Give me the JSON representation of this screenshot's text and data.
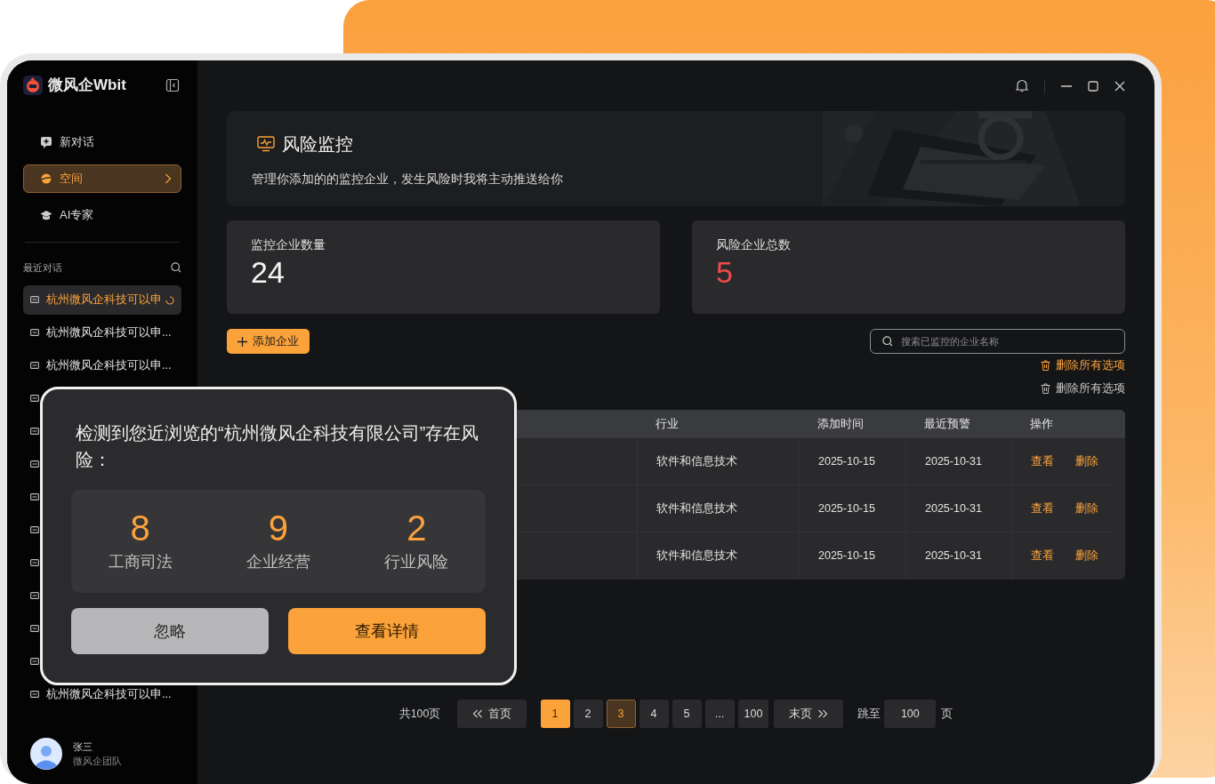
{
  "app": {
    "name": "微风企Wbit"
  },
  "menu": [
    {
      "label": "新对话",
      "kind": "new-chat",
      "selected": false
    },
    {
      "label": "空间",
      "kind": "space",
      "selected": true
    },
    {
      "label": "AI专家",
      "kind": "expert",
      "selected": false
    }
  ],
  "recent": {
    "title": "最近对话",
    "items": [
      {
        "kind": "chat",
        "text": "杭州微风企科技可以申",
        "selected": true,
        "loading": true
      },
      {
        "kind": "chat",
        "text": "杭州微风企科技可以申...",
        "selected": false,
        "loading": false
      },
      {
        "kind": "chat",
        "text": "杭州微风企科技可以申...",
        "selected": false,
        "loading": false
      },
      {
        "kind": "covered"
      },
      {
        "kind": "covered"
      },
      {
        "kind": "covered"
      },
      {
        "kind": "covered"
      },
      {
        "kind": "covered"
      },
      {
        "kind": "covered"
      },
      {
        "kind": "covered"
      },
      {
        "kind": "covered"
      },
      {
        "kind": "covered"
      },
      {
        "kind": "chat",
        "text": "杭州微风企科技可以申...",
        "selected": false,
        "loading": false
      }
    ]
  },
  "user": {
    "name": "张三",
    "team": "微风企团队"
  },
  "page": {
    "title": "风险监控",
    "subtitle": "管理你添加的的监控企业，发生风险时我将主动推送给你"
  },
  "stats": [
    {
      "label": "监控企业数量",
      "value": "24",
      "alert": false
    },
    {
      "label": "风险企业总数",
      "value": "5",
      "alert": true
    }
  ],
  "add_button": "添加企业",
  "search": {
    "placeholder": "搜索已监控的企业名称"
  },
  "bulk_actions": [
    {
      "label": "删除所有选项",
      "selected": true
    },
    {
      "label": "删除所有选项",
      "selected": false
    }
  ],
  "table": {
    "columns": [
      "行业",
      "添加时间",
      "最近预警",
      "操作"
    ],
    "rows": [
      {
        "industry": "软件和信息技术",
        "added": "2025-10-15",
        "warning": "2025-10-31",
        "actions": [
          "查看",
          "删除"
        ]
      },
      {
        "industry": "软件和信息技术",
        "added": "2025-10-15",
        "warning": "2025-10-31",
        "actions": [
          "查看",
          "删除"
        ]
      },
      {
        "industry": "软件和信息技术",
        "added": "2025-10-15",
        "warning": "2025-10-31",
        "actions": [
          "查看",
          "删除"
        ]
      }
    ]
  },
  "pagination": {
    "total": "共100页",
    "first": "首页",
    "last": "末页",
    "pages": [
      {
        "label": "1",
        "selected": true,
        "hovered": false
      },
      {
        "label": "2",
        "selected": false,
        "hovered": false
      },
      {
        "label": "3",
        "selected": false,
        "hovered": true
      },
      {
        "label": "4",
        "selected": false,
        "hovered": false
      },
      {
        "label": "5",
        "selected": false,
        "hovered": false
      },
      {
        "label": "...",
        "selected": false,
        "hovered": false
      },
      {
        "label": "100",
        "selected": false,
        "hovered": false
      }
    ],
    "jump_label": "跳至",
    "jump_value": "100",
    "unit": "页"
  },
  "popup": {
    "message": "检测到您近浏览的“杭州微风企科技有限公司”存在风险：",
    "metrics": [
      {
        "value": "8",
        "label": "工商司法"
      },
      {
        "value": "9",
        "label": "企业经营"
      },
      {
        "value": "2",
        "label": "行业风险"
      }
    ],
    "buttons": [
      {
        "label": "忽略",
        "kind": "secondary"
      },
      {
        "label": "查看详情",
        "kind": "primary"
      }
    ]
  }
}
